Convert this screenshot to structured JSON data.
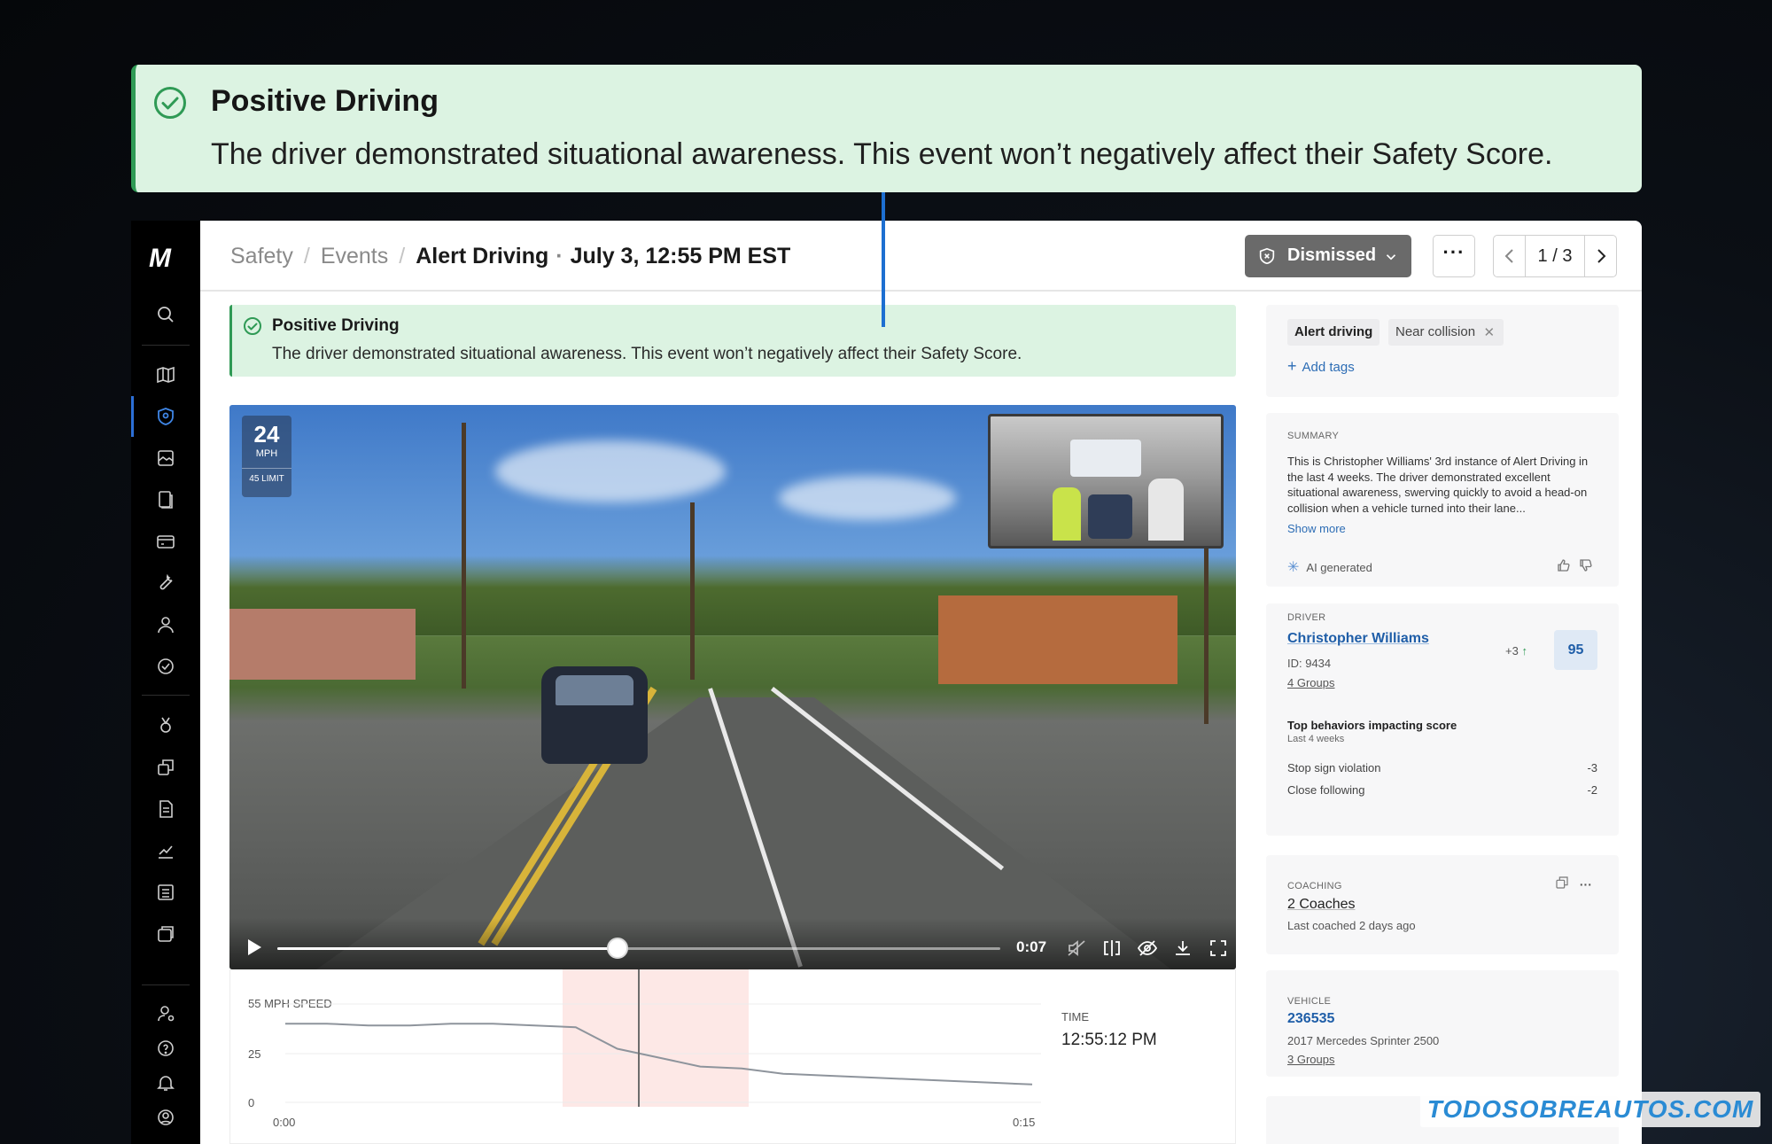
{
  "callout": {
    "title": "Positive Driving",
    "text": "The driver demonstrated situational awareness. This event won’t negatively affect their Safety Score."
  },
  "nav": {
    "logo": "M",
    "icons": [
      "search-icon",
      "map-icon",
      "safety-shield-icon",
      "gallery-icon",
      "documents-icon",
      "card-icon",
      "tools-icon",
      "user-icon",
      "compliance-icon",
      "awards-icon",
      "copy-icon",
      "report-icon",
      "analytics-icon",
      "list-icon",
      "storage-icon",
      "account-icon",
      "help-icon",
      "bell-icon",
      "profile-icon"
    ],
    "active": "safety"
  },
  "header": {
    "crumb1": "Safety",
    "crumb2": "Events",
    "current": "Alert Driving",
    "datetime": "July 3, 12:55 PM EST",
    "status": "Dismissed",
    "more": "···",
    "pager": "1 / 3"
  },
  "banner": {
    "title": "Positive Driving",
    "text": "The driver demonstrated situational awareness. This event won’t negatively affect their Safety Score."
  },
  "video": {
    "speed": "24",
    "speed_unit": "MPH",
    "limit": "45 LIMIT",
    "time": "0:07",
    "progress": 0.47
  },
  "speed_chart": {
    "ylabel": "55 MPH SPEED",
    "y_ticks": [
      "25",
      "0"
    ],
    "x_start": "0:00",
    "x_end": "0:15",
    "time_label": "TIME",
    "time_value": "12:55:12 PM",
    "series": [
      44,
      44,
      43,
      43,
      44,
      44,
      43,
      42,
      30,
      25,
      20,
      19,
      16,
      15,
      14,
      13,
      12,
      11,
      10
    ]
  },
  "tags": {
    "tag1": "Alert driving",
    "tag2": "Near collision",
    "add": "Add tags"
  },
  "summary": {
    "eyebrow": "SUMMARY",
    "body": "This is Christopher Williams' 3rd instance of Alert Driving in the last 4 weeks. The driver demonstrated excellent situational awareness, swerving quickly to avoid a head-on collision when a vehicle turned into their lane...",
    "more": "Show more",
    "ai": "AI generated"
  },
  "driver": {
    "eyebrow": "DRIVER",
    "name": "Christopher Williams",
    "id": "ID: 9434",
    "groups": "4 Groups",
    "delta": "+3",
    "score": "95",
    "behaviors_title": "Top behaviors impacting score",
    "behaviors_sub": "Last 4 weeks",
    "behaviors": [
      {
        "label": "Stop sign violation",
        "points": "-3"
      },
      {
        "label": "Close following",
        "points": "-2"
      }
    ]
  },
  "coaching": {
    "eyebrow": "COACHING",
    "count": "2 Coaches",
    "last": "Last coached 2 days ago",
    "more": "···"
  },
  "vehicle": {
    "eyebrow": "VEHICLE",
    "number": "236535",
    "model": "2017 Mercedes Sprinter 2500",
    "groups": "3 Groups"
  },
  "watermark": "TODOSOBREAUTOS.COM",
  "colors": {
    "accent": "#2c6fd6",
    "positive": "#2f9a55",
    "banner_bg": "#dcf3e2",
    "link": "#1f5ea8"
  }
}
